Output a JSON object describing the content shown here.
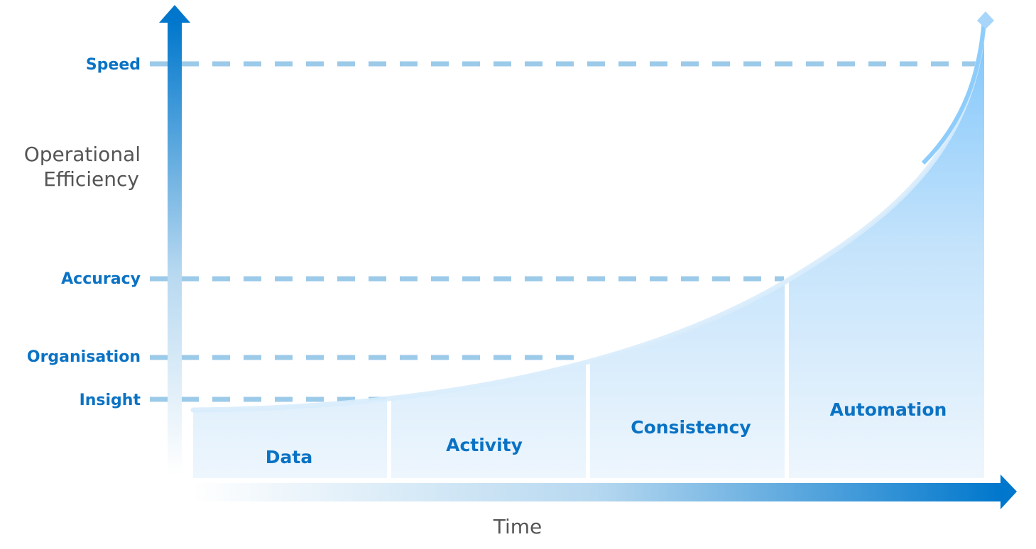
{
  "diagram": {
    "y_axis_title": [
      "Operational",
      "Efficiency"
    ],
    "x_axis_title": "Time",
    "levels": [
      {
        "label": "Speed"
      },
      {
        "label": "Accuracy"
      },
      {
        "label": "Organisation"
      },
      {
        "label": "Insight"
      }
    ],
    "stages": [
      {
        "label": "Data"
      },
      {
        "label": "Activity"
      },
      {
        "label": "Consistency"
      },
      {
        "label": "Automation"
      }
    ],
    "colors": {
      "primary": "#0077cc",
      "label": "#0a72c4",
      "axis_title": "#555555",
      "dash": "#9ccae9",
      "curve": "#7cc4fb",
      "stage_fill_light": "#eef6fd"
    }
  }
}
